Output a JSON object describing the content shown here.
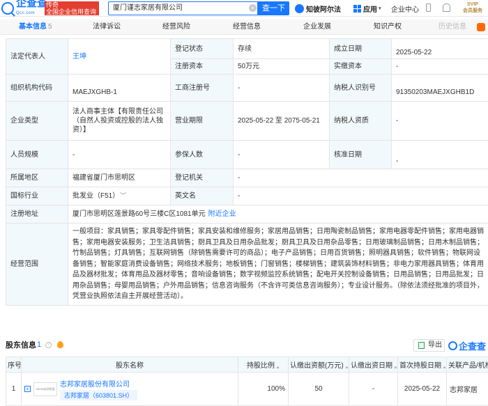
{
  "header": {
    "logo_text": "企查查",
    "logo_sub": "Qcc.com",
    "slogan_line1": "传奇",
    "slogan_line2": "全国企业信用查询",
    "search_value": "厦门谨志家居有限公司",
    "search_button": "查一下",
    "nav_zhibi": "知彼阿尔法",
    "nav_app": "应用",
    "nav_center": "企业中心",
    "vip_line1": "SVIP",
    "vip_line2": "会员服务",
    "brand_color": "#1878ff"
  },
  "tabs": [
    {
      "label": "基本信息",
      "count": "5"
    },
    {
      "label": "法律诉讼"
    },
    {
      "label": "经营风险"
    },
    {
      "label": "经营信息"
    },
    {
      "label": "企业发展"
    },
    {
      "label": "知识产权"
    },
    {
      "label": "历史信息"
    }
  ],
  "info": {
    "legal_rep_label": "法定代表人",
    "legal_rep_value": "王坤",
    "reg_status_label": "登记状态",
    "reg_status_value": "存续",
    "est_date_label": "成立日期",
    "est_date_value": "2025-05-22",
    "reg_capital_label": "注册资本",
    "reg_capital_value": "50万元",
    "paid_capital_label": "实缴资本",
    "paid_capital_value": "-",
    "org_code_label": "组织机构代码",
    "org_code_value": "MAEJXGHB-1",
    "biz_reg_no_label": "工商注册号",
    "biz_reg_no_value": "-",
    "taxpayer_id_label": "纳税人识别号",
    "taxpayer_id_value": "91350203MAEJXGHB1D",
    "company_type_label": "企业类型",
    "company_type_value": "法人商事主体【有限责任公司（自然人投资或控股的法人独资）】",
    "biz_term_label": "营业期限",
    "biz_term_value": "2025-05-22 至 2075-05-21",
    "taxpayer_qual_label": "纳税人资质",
    "taxpayer_qual_value": "-",
    "staff_size_label": "人员规模",
    "staff_size_value": "-",
    "insured_label": "参保人数",
    "insured_value": "-",
    "approval_date_label": "核准日期",
    "approval_date_value": "-",
    "region_label": "所属地区",
    "region_value": "福建省厦门市思明区",
    "reg_authority_label": "登记机关",
    "reg_authority_value": "-",
    "industry_label": "国标行业",
    "industry_value": "批发业（F51）",
    "english_name_label": "英文名",
    "english_name_value": "-",
    "address_label": "注册地址",
    "address_value": "厦门市思明区莲景路60号三楼C区1081单元",
    "nearby_link": "附近企业",
    "scope_label": "经营范围",
    "scope_value": "一般项目：家具销售；家具零配件销售；家具安装和维修服务；家居用品销售；日用陶瓷制品销售；家用电器零配件销售；家用电器销售；家用电器安装服务；卫生洁具销售；厨具卫具及日用杂品批发；厨具卫具及日用杂品零售；日用玻璃制品销售；日用木制品销售；竹制品销售；灯具销售；互联网销售（除销售需要许可的商品）；电子产品销售；日用百货销售；照明器具销售；软件销售；物联网设备销售；智能家庭消费设备销售；网络技术服务；地板销售；门窗销售；楼梯销售；建筑装饰材料销售；非电力家用器具销售；体育用品及器材批发；体育用品及器材零售；音响设备销售；数字视频监控系统销售；配电开关控制设备销售；日用品销售；日用品批发；日用杂品销售；母婴用品销售；户外用品销售；信息咨询服务（不含许可类信息咨询服务）；专业设计服务。（除依法须经批准的项目外，凭营业执照依法自主开展经营活动）。"
  },
  "shareholders": {
    "title": "股东信息",
    "count": "1",
    "export_label": "导出",
    "qcc_label": "企查查",
    "columns": [
      "序号",
      "股东名称",
      "持股比例",
      "认缴出资额(万元)",
      "认缴出资日期",
      "首次持股日期",
      "关联产品/机构"
    ],
    "rows": [
      {
        "index": "1",
        "name": "志邦家居股份有限公司",
        "logo_text": "ZBOM志邦家居",
        "stock": "志邦家居（603801.SH）",
        "ratio": "100%",
        "amount": "50",
        "sub_date": "-",
        "first_date": "2025-05-22",
        "product": "志邦家居"
      }
    ]
  }
}
